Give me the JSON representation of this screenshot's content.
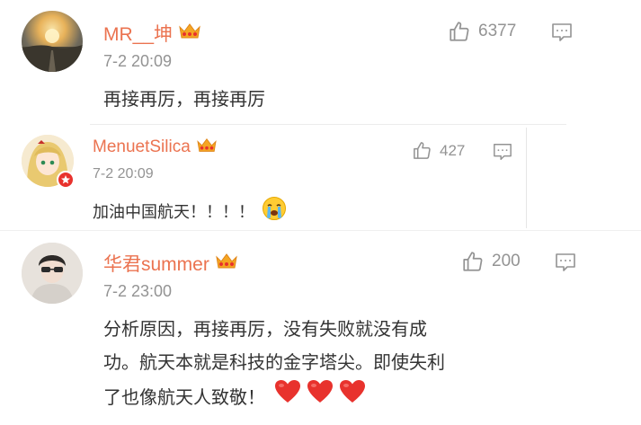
{
  "comments": [
    {
      "username": "MR__坤",
      "time": "7-2 20:09",
      "text": "再接再厉，再接再厉",
      "likes": "6377"
    },
    {
      "username": "MenuetSilica",
      "time": "7-2 20:09",
      "text": "加油中国航天！！！！",
      "likes": "427"
    },
    {
      "username": "华君summer",
      "time": "7-2 23:00",
      "text_lines": [
        "分析原因，再接再厉，没有失败就没有成",
        "功。航天本就是科技的金字塔尖。即使失利",
        "了也像航天人致敬！"
      ],
      "likes": "200"
    }
  ],
  "colors": {
    "username": "#eb7350",
    "time": "#939393",
    "text": "#333333",
    "crown": "#f5a623",
    "heart": "#e8322d"
  },
  "icons": {
    "like": "thumbs-up-icon",
    "reply": "comment-bubble-icon",
    "crown": "vip-crown-icon",
    "crying_emoji": "crying-face-emoji",
    "heart": "red-heart-emoji"
  }
}
